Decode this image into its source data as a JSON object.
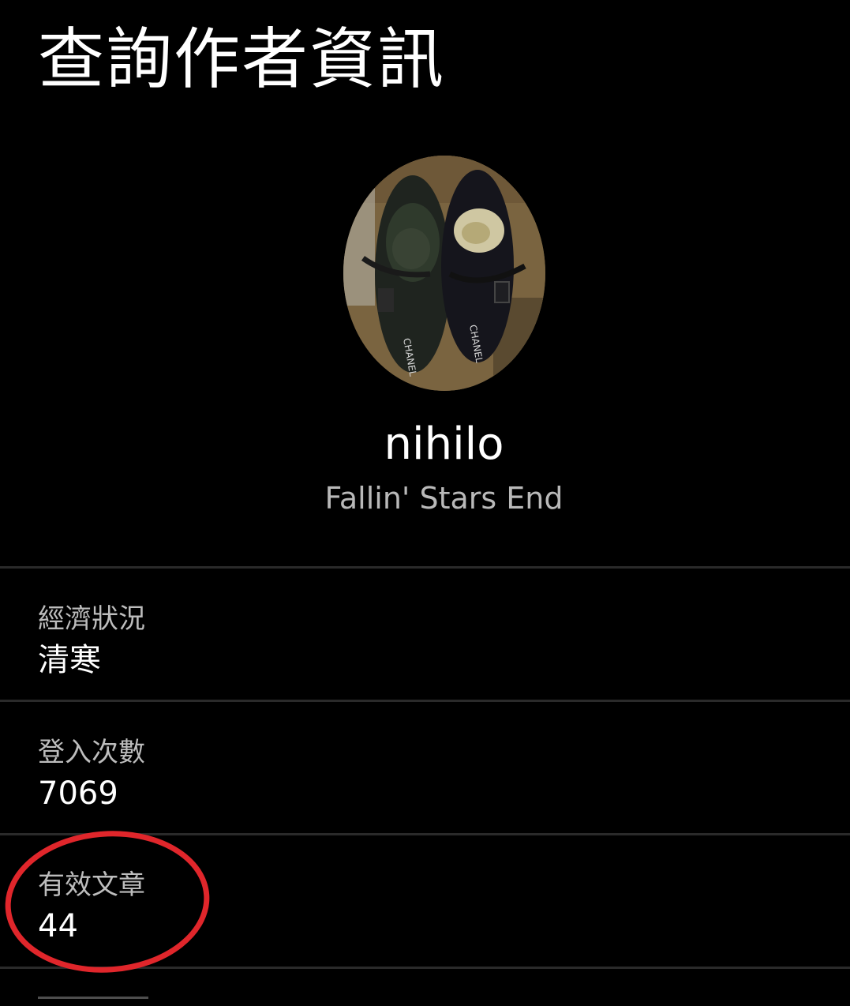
{
  "header": {
    "title": "查詢作者資訊"
  },
  "profile": {
    "username": "nihilo",
    "nickname": "Fallin' Stars End",
    "avatar_icon": "sandals-photo-avatar",
    "avatar_text": "CHANEL"
  },
  "fields": [
    {
      "label": "經濟狀況",
      "value": "清寒"
    },
    {
      "label": "登入次數",
      "value": "7069"
    },
    {
      "label": "有效文章",
      "value": "44"
    }
  ],
  "annotation": {
    "shape": "ellipse",
    "color": "#e0262b",
    "target": "有效文章"
  },
  "colors": {
    "background": "#000000",
    "primary_text": "#ffffff",
    "secondary_text": "#bdbdbd",
    "divider": "#2a2a2a",
    "annotation": "#e0262b"
  }
}
